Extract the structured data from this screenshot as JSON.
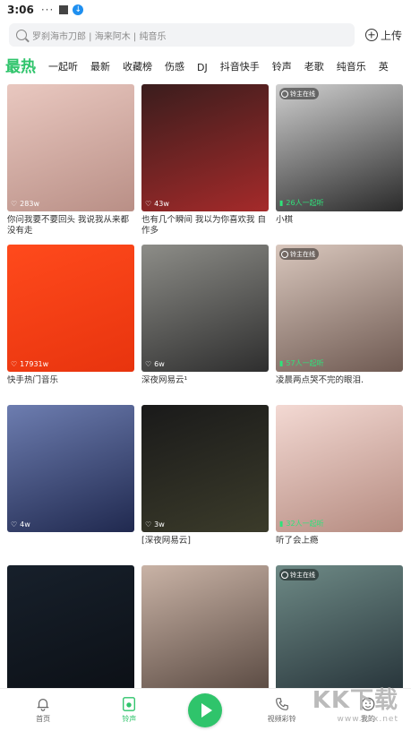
{
  "status": {
    "time": "3:06",
    "dots": "···"
  },
  "search": {
    "placeholder": "罗刹海市刀郎 | 海来阿木 | 纯音乐"
  },
  "upload": {
    "label": "上传"
  },
  "tabs": [
    "最热",
    "一起听",
    "最新",
    "收藏榜",
    "伤感",
    "DJ",
    "抖音快手",
    "铃声",
    "老歌",
    "纯音乐",
    "英"
  ],
  "cards": [
    {
      "title": "你问我要不要回头 我说我从来都没有走",
      "count": "283w",
      "badge": "",
      "colors": [
        "#e9c8c0",
        "#b98f86"
      ]
    },
    {
      "title": "也有几个瞬间 我以为你喜欢我 自作多",
      "count": "43w",
      "badge": "",
      "colors": [
        "#3a1d1d",
        "#a52a2a"
      ]
    },
    {
      "title": "小棋",
      "count": "26人一起听",
      "badge": "铃主在线",
      "colors": [
        "#cfcfcf",
        "#2a2a2a"
      ]
    },
    {
      "title": "快手热门音乐",
      "count": "17931w",
      "badge": "",
      "colors": [
        "#ff4a1c",
        "#e8340e"
      ]
    },
    {
      "title": "深夜网易云¹",
      "count": "6w",
      "badge": "",
      "colors": [
        "#8d8d88",
        "#2e2e2e"
      ]
    },
    {
      "title": "凌晨两点哭不完的眼泪.",
      "count": "57人一起听",
      "badge": "铃主在线",
      "colors": [
        "#d9c7bd",
        "#6f5a52"
      ]
    },
    {
      "title": "",
      "count": "4w",
      "badge": "",
      "colors": [
        "#6d7db0",
        "#20294f"
      ]
    },
    {
      "title": "[深夜网易云]",
      "count": "3w",
      "badge": "",
      "colors": [
        "#1a1a1a",
        "#3b3b2a"
      ]
    },
    {
      "title": "听了会上瘾",
      "count": "32人一起听",
      "badge": "",
      "colors": [
        "#f3d9d3",
        "#b58b80"
      ]
    },
    {
      "title": "",
      "count": "",
      "badge": "",
      "colors": [
        "#17202b",
        "#0c1016"
      ]
    },
    {
      "title": "",
      "count": "",
      "badge": "",
      "colors": [
        "#c9b3a6",
        "#5a4a42"
      ]
    },
    {
      "title": "",
      "count": "",
      "badge": "铃主在线",
      "colors": [
        "#6e8a86",
        "#27343a"
      ]
    }
  ],
  "nav": [
    {
      "label": "首页",
      "icon": "bell-icon"
    },
    {
      "label": "铃声",
      "icon": "music-icon"
    },
    {
      "label": "",
      "icon": "play-icon"
    },
    {
      "label": "视频彩铃",
      "icon": "phone-icon"
    },
    {
      "label": "我的",
      "icon": "face-icon"
    }
  ],
  "watermark": {
    "text": "KK下载",
    "url": "www.kkx.net"
  },
  "accent": "#2fc46b"
}
